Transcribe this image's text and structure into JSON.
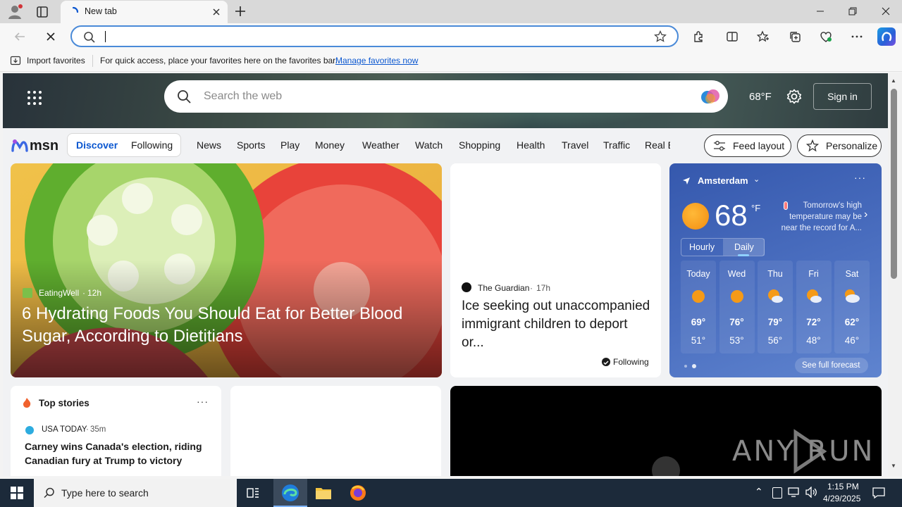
{
  "browser": {
    "tab_title": "New tab",
    "address_value": ""
  },
  "favorites_bar": {
    "import_label": "Import favorites",
    "hint_text": "For quick access, place your favorites here on the favorites bar.",
    "manage_link": "Manage favorites now"
  },
  "hero": {
    "search_placeholder": "Search the web",
    "temperature": "68°F",
    "signin_label": "Sign in"
  },
  "msn_nav": {
    "logo": "msn",
    "discover": "Discover",
    "following": "Following",
    "items": [
      "News",
      "Sports",
      "Play",
      "Money",
      "Weather",
      "Watch",
      "Shopping",
      "Health",
      "Travel",
      "Traffic",
      "Real E"
    ],
    "feed_layout": "Feed layout",
    "personalize": "Personalize"
  },
  "feature_card": {
    "source": "EatingWell",
    "age": "12h",
    "headline": "6 Hydrating Foods You Should Eat for Better Blood Sugar, According to Dietitians"
  },
  "guardian_card": {
    "source": "The Guardian",
    "age": "17h",
    "headline": "Ice seeking out unaccompanied immigrant children to deport or...",
    "following_label": "Following"
  },
  "weather": {
    "location": "Amsterdam",
    "temp": "68",
    "unit": "°F",
    "note": "Tomorrow's high temperature may be near the record for A...",
    "tab_hourly": "Hourly",
    "tab_daily": "Daily",
    "days": [
      {
        "day": "Today",
        "high": "69°",
        "low": "51°",
        "icon": "sun-icon"
      },
      {
        "day": "Wed",
        "high": "76°",
        "low": "53°",
        "icon": "sun-icon"
      },
      {
        "day": "Thu",
        "high": "79°",
        "low": "56°",
        "icon": "partly-cloudy-icon"
      },
      {
        "day": "Fri",
        "high": "72°",
        "low": "48°",
        "icon": "partly-cloudy-icon"
      },
      {
        "day": "Sat",
        "high": "62°",
        "low": "46°",
        "icon": "cloudy-icon"
      }
    ],
    "see_full": "See full forecast"
  },
  "top_stories": {
    "title": "Top stories",
    "source": "USA TODAY",
    "age": "35m",
    "headline": "Carney wins Canada's election, riding Canadian fury at Trump to victory"
  },
  "video_card": {
    "watermark": "ANY RUN"
  },
  "taskbar": {
    "search_placeholder": "Type here to search",
    "time": "1:15 PM",
    "date": "4/29/2025"
  },
  "colors": {
    "accent": "#0b57d0",
    "weather_bg": "#3f63b7",
    "taskbar": "#1c2a3a"
  }
}
